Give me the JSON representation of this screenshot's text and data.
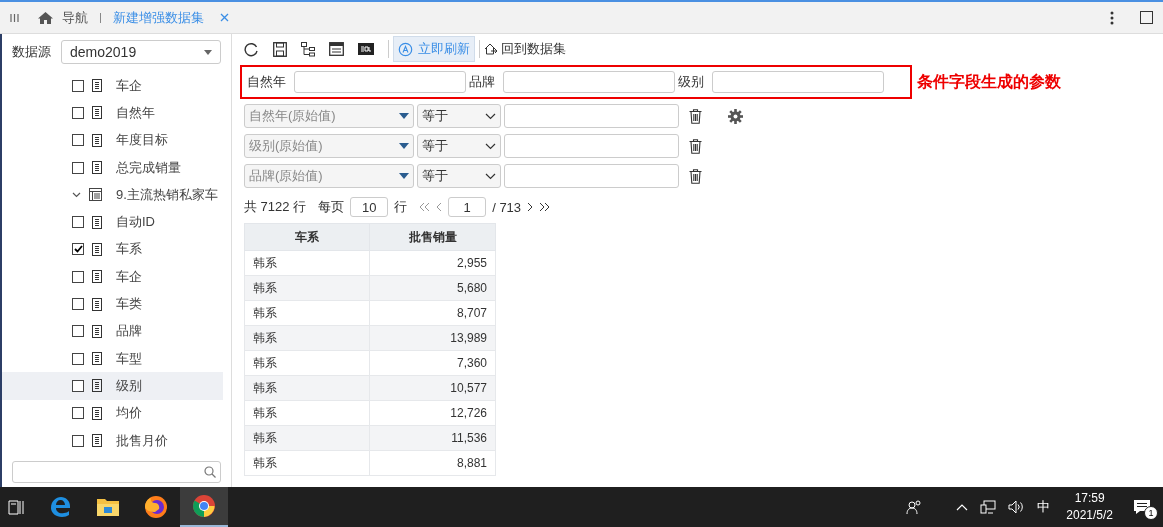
{
  "tabbar": {
    "nav_label": "导航",
    "tabs": [
      {
        "label": "新建增强数据集",
        "selected": true
      }
    ]
  },
  "sidebar": {
    "datasource_label": "数据源",
    "datasource": "demo2019",
    "tree": [
      {
        "kind": "group",
        "children": [
          {
            "kind": "field",
            "label": "车企",
            "checked": false,
            "selected": false
          },
          {
            "kind": "field",
            "label": "自然年",
            "checked": false,
            "selected": false
          },
          {
            "kind": "field",
            "label": "年度目标",
            "checked": false,
            "selected": false
          },
          {
            "kind": "field",
            "label": "总完成销量",
            "checked": false,
            "selected": false
          }
        ]
      },
      {
        "kind": "table",
        "label": "9.主流热销私家车",
        "expanded": true,
        "selected": false,
        "children": [
          {
            "kind": "field",
            "label": "自动ID",
            "checked": false,
            "selected": false
          },
          {
            "kind": "field",
            "label": "车系",
            "checked": true,
            "selected": false
          },
          {
            "kind": "field",
            "label": "车企",
            "checked": false,
            "selected": false
          },
          {
            "kind": "field",
            "label": "车类",
            "checked": false,
            "selected": false
          },
          {
            "kind": "field",
            "label": "品牌",
            "checked": false,
            "selected": false
          },
          {
            "kind": "field",
            "label": "车型",
            "checked": false,
            "selected": false
          },
          {
            "kind": "field",
            "label": "级别",
            "checked": false,
            "selected": true
          },
          {
            "kind": "field",
            "label": "均价",
            "checked": false,
            "selected": false
          },
          {
            "kind": "field",
            "label": "批售月价",
            "checked": false,
            "selected": false
          }
        ]
      }
    ]
  },
  "toolbar": {
    "refresh_label": "立即刷新",
    "refresh_active": true,
    "back_label": "回到数据集"
  },
  "params": [
    {
      "label": "自然年"
    },
    {
      "label": "品牌"
    },
    {
      "label": "级别"
    }
  ],
  "params_note": "条件字段生成的参数",
  "filters": [
    {
      "field": "自然年(原始值)",
      "operator": "等于",
      "settings": true
    },
    {
      "field": "级别(原始值)",
      "operator": "等于",
      "settings": false
    },
    {
      "field": "品牌(原始值)",
      "operator": "等于",
      "settings": false
    }
  ],
  "pagination": {
    "total": "共 7122 行",
    "per_page_label": "每页",
    "per_page": "10",
    "rows_label": "行",
    "page": "1",
    "pages": "/ 713"
  },
  "table": {
    "columns": [
      "车系",
      "批售销量"
    ],
    "rows": [
      [
        "韩系",
        "2,955"
      ],
      [
        "韩系",
        "5,680"
      ],
      [
        "韩系",
        "8,707"
      ],
      [
        "韩系",
        "13,989"
      ],
      [
        "韩系",
        "7,360"
      ],
      [
        "韩系",
        "10,577"
      ],
      [
        "韩系",
        "12,726"
      ],
      [
        "韩系",
        "11,536"
      ],
      [
        "韩系",
        "8,881"
      ]
    ]
  },
  "taskbar": {
    "apps": [
      {
        "kind": "edge",
        "selected": false
      },
      {
        "kind": "folder",
        "selected": false
      },
      {
        "kind": "firefox",
        "selected": false
      },
      {
        "kind": "chrome",
        "selected": true
      }
    ],
    "ime": "中",
    "time": "17:59",
    "date": "2021/5/2",
    "notifications": "1"
  }
}
